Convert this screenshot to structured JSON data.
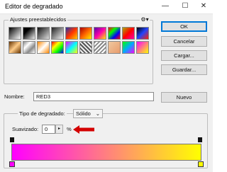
{
  "window": {
    "title": "Editor de degradado",
    "minimize": "—",
    "maximize": "☐",
    "close": "✕"
  },
  "presets": {
    "legend": "Ajustes preestablecidos",
    "gear_icon": "gear-icon",
    "swatches": [
      "linear-gradient(135deg,#000,#fff)",
      "linear-gradient(135deg,#000,#000 30%,transparent)",
      "linear-gradient(135deg,#111,#ddd)",
      "linear-gradient(135deg,#222,#f5f5f5)",
      "linear-gradient(135deg,#2233aa,#ff3300,#ffcc00)",
      "linear-gradient(135deg,#aa0000,#ff6600,#ffee00)",
      "linear-gradient(135deg,#5500aa,#ff00aa,#ffee00)",
      "linear-gradient(135deg,#ff0000,#00ff00,#0000ff,#ff0000)",
      "linear-gradient(135deg,#aaaa00,#ff0000,#ff00aa)",
      "linear-gradient(135deg,#000,#2244ff,#ff2200)",
      "linear-gradient(135deg,#663300,#ffcc88,#663300)",
      "linear-gradient(135deg,#888,#fff,#888,#fff)",
      "linear-gradient(135deg,#ff8800,#fff,#ff8800)",
      "linear-gradient(135deg,#ff0000,#ffff00,#00ff00,#0000ff)",
      "linear-gradient(135deg,#ff00ff,#00ffff,#ffff00)",
      "repeating-linear-gradient(45deg,#555 0 2px,#eee 2px 4px)",
      "repeating-linear-gradient(135deg,#888 0 2px,#fff 2px 4px)",
      "linear-gradient(135deg,#f0c8a0,#e89c6c)",
      "linear-gradient(135deg,#00ff00,#00aaff,#ff00ff)",
      "linear-gradient(135deg,#ff00ff,#ffff00)"
    ]
  },
  "buttons": {
    "ok": "OK",
    "cancel": "Cancelar",
    "load": "Cargar...",
    "save": "Guardar...",
    "new": "Nuevo"
  },
  "name": {
    "label": "Nombre:",
    "value": "RED3"
  },
  "gradient": {
    "type_label": "Tipo de degradado:",
    "type_value": "Sólido",
    "smooth_label": "Suavizado:",
    "smooth_value": "0",
    "smooth_unit": "%",
    "colors": {
      "start": "#ff00ff",
      "end": "#ffff00",
      "arrow": "#d40000"
    }
  }
}
